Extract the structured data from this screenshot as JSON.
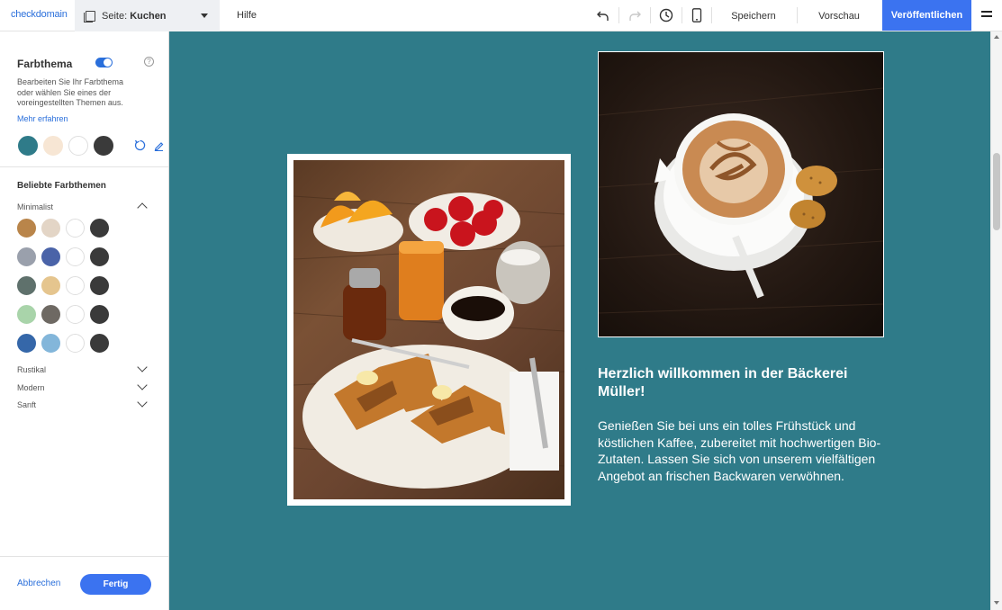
{
  "topbar": {
    "logo_brand": "checkdomain",
    "page_prefix": "Seite: ",
    "page_name": "Kuchen",
    "help": "Hilfe",
    "save": "Speichern",
    "preview": "Vorschau",
    "publish": "Veröffentlichen"
  },
  "sidebar": {
    "title": "Farbthema",
    "description": "Bearbeiten Sie Ihr Farbthema oder wählen Sie eines der voreingestellten Themen aus.",
    "learn_more": "Mehr erfahren",
    "current_colors": [
      "#2f7b89",
      "#f7e6d4",
      "#ffffff",
      "#3a3a3a"
    ],
    "popular_title": "Beliebte Farbthemen",
    "groups": [
      {
        "name": "Minimalist",
        "expanded": true,
        "palettes": [
          [
            "#b9854a",
            "#e3d5c6",
            "#ffffff",
            "#3a3a3a"
          ],
          [
            "#9aa0ac",
            "#4a63a8",
            "#ffffff",
            "#3a3a3a"
          ],
          [
            "#5f716c",
            "#e5c58e",
            "#ffffff",
            "#3a3a3a"
          ],
          [
            "#a9d4aa",
            "#6e6963",
            "#ffffff",
            "#3a3a3a"
          ],
          [
            "#3567a9",
            "#83b6da",
            "#ffffff",
            "#3a3a3a"
          ]
        ]
      },
      {
        "name": "Rustikal",
        "expanded": false
      },
      {
        "name": "Modern",
        "expanded": false
      },
      {
        "name": "Sanft",
        "expanded": false
      }
    ],
    "cancel": "Abbrechen",
    "done": "Fertig"
  },
  "content": {
    "welcome_title": "Herzlich willkommen in der Bäckerei Müller!",
    "welcome_text": "Genießen Sie bei uns ein tolles Frühstück und köstlichen Kaffee, zubereitet mit hochwertigen Bio-Zutaten. Lassen Sie sich von unserem vielfältigen Angebot an frischen Backwaren verwöhnen."
  },
  "colors": {
    "accent": "#3b73f0",
    "canvas_bg": "#2f7b89",
    "link": "#2a6fdb"
  }
}
